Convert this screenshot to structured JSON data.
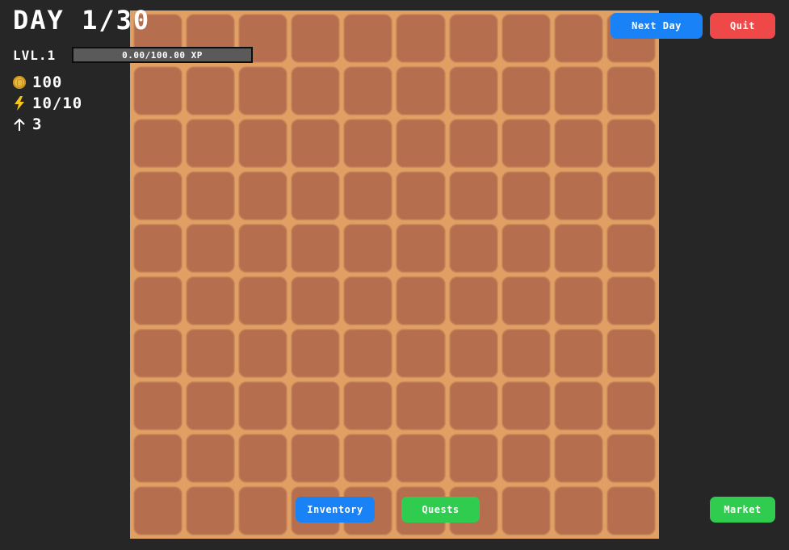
{
  "hud": {
    "day_label": "DAY 1/30",
    "level_label": "LVL.1",
    "xp_text": "0.00/100.00 XP",
    "xp_progress": 0.0,
    "coins": "100",
    "energy": "10/10",
    "upgrades": "3"
  },
  "buttons": {
    "next_day": "Next Day",
    "quit": "Quit",
    "inventory": "Inventory",
    "quests": "Quests",
    "market": "Market"
  },
  "icons": {
    "coin": "coin-icon",
    "energy": "lightning-bolt-icon",
    "upgrade": "up-arrow-icon"
  },
  "field": {
    "rows": 10,
    "columns": 10,
    "tile_type": "tilled-soil"
  },
  "colors": {
    "background": "#262626",
    "soil": "#b56f4e",
    "soil_border": "#e0a063",
    "blue_button": "#1a82f7",
    "red_button": "#ef4848",
    "green_button": "#2fcc4f"
  }
}
